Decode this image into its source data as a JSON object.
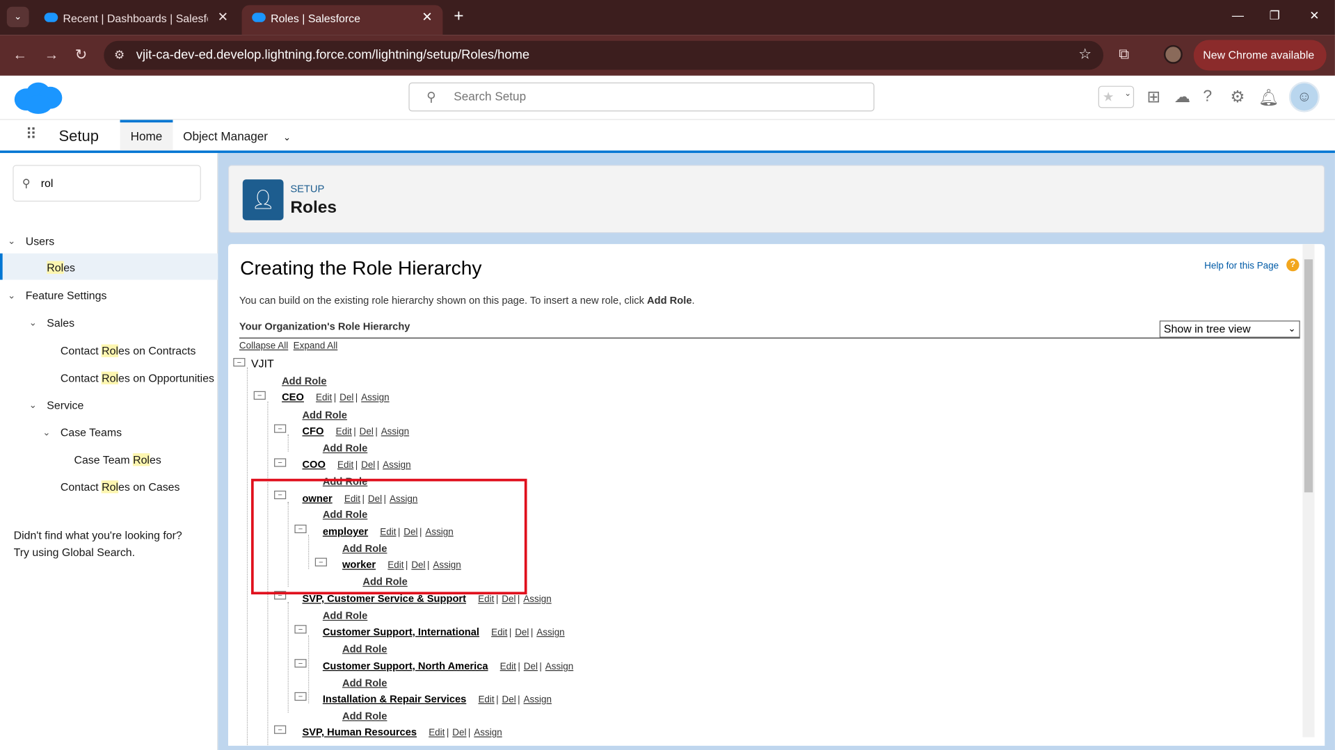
{
  "browser": {
    "tabs": [
      {
        "title": "Recent | Dashboards | Salesforce"
      },
      {
        "title": "Roles | Salesforce"
      }
    ],
    "url": "vjit-ca-dev-ed.develop.lightning.force.com/lightning/setup/Roles/home",
    "update_button": "New Chrome available"
  },
  "header": {
    "search_placeholder": "Search Setup",
    "app_name": "Setup",
    "nav_home": "Home",
    "nav_object_manager": "Object Manager"
  },
  "sidebar": {
    "quick_find_value": "rol",
    "items": {
      "users": "Users",
      "roles_a": "Rol",
      "roles_b": "es",
      "feature_settings": "Feature Settings",
      "sales": "Sales",
      "crc_pre": "Contact ",
      "crc_hl": "Rol",
      "crc_post": "es on Contracts",
      "cro_pre": "Contact ",
      "cro_hl": "Rol",
      "cro_post": "es on Opportunities",
      "service": "Service",
      "case_teams": "Case Teams",
      "ctr_pre": "Case Team ",
      "ctr_hl": "Rol",
      "ctr_post": "es",
      "crcs_pre": "Contact ",
      "crcs_hl": "Rol",
      "crcs_post": "es on Cases"
    },
    "not_found_line1": "Didn't find what you're looking for?",
    "not_found_line2": "Try using Global Search."
  },
  "page_header": {
    "eyebrow": "SETUP",
    "title": "Roles"
  },
  "content": {
    "heading": "Creating the Role Hierarchy",
    "help_link": "Help for this Page",
    "intro_text": "You can build on the existing role hierarchy shown on this page. To insert a new role, click ",
    "intro_bold": "Add Role",
    "intro_end": ".",
    "org_hierarchy_label": "Your Organization's Role Hierarchy",
    "view_select": "Show in tree view",
    "collapse_all": "Collapse All",
    "expand_all": "Expand All",
    "root": "VJIT",
    "add_role": "Add Role",
    "actions": {
      "edit": "Edit",
      "del": "Del",
      "assign": "Assign",
      "sep": "|"
    },
    "roles": {
      "ceo": "CEO",
      "cfo": "CFO",
      "coo": "COO",
      "owner": "owner",
      "employer": "employer",
      "worker": "worker",
      "svp_cs": "SVP, Customer Service & Support",
      "cs_intl": "Customer Support, International",
      "cs_na": "Customer Support, North America",
      "install": "Installation & Repair Services",
      "svp_hr": "SVP, Human Resources"
    }
  },
  "colors": {
    "chrome_dark": "#3c1e1e",
    "chrome_active": "#5c2b2b",
    "sf_blue": "#0176d3",
    "highlight_box": "#e0101d"
  }
}
